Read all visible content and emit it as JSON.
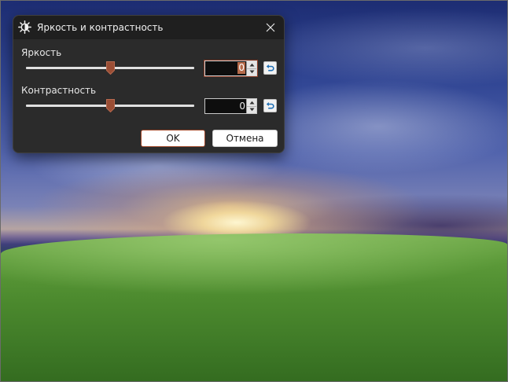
{
  "dialog": {
    "title": "Яркость и контрастность",
    "brightness": {
      "label": "Яркость",
      "value": "0",
      "slider_fraction": 0.5
    },
    "contrast": {
      "label": "Контрастность",
      "value": "0",
      "slider_fraction": 0.5
    },
    "ok_label": "OK",
    "cancel_label": "Отмена"
  },
  "colors": {
    "accent": "#8a3a24",
    "dialog_bg": "#2b2b2b",
    "titlebar_bg": "#1f1f1f",
    "reset_icon": "#1e6fb5"
  },
  "icons": {
    "title": "brightness-contrast-icon",
    "close": "close-icon",
    "reset": "undo-icon",
    "spin_up": "chevron-up-icon",
    "spin_down": "chevron-down-icon"
  }
}
